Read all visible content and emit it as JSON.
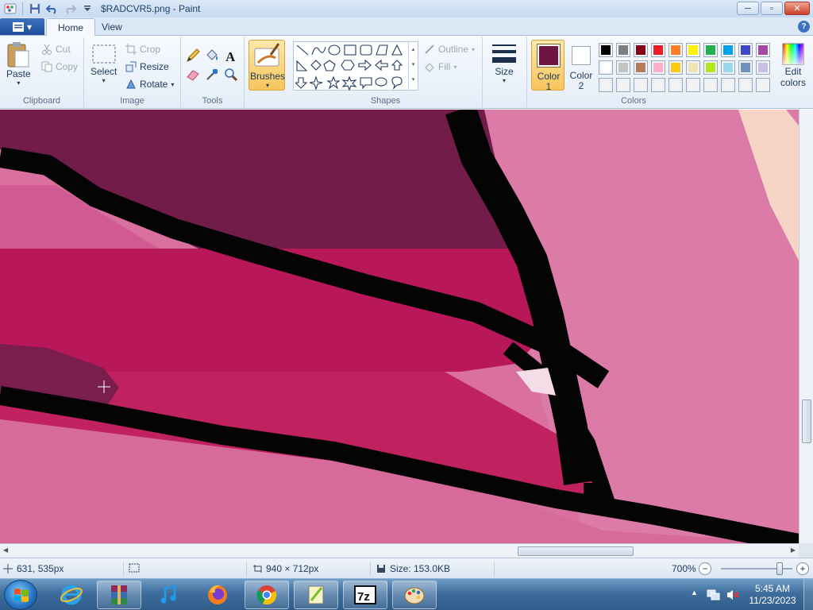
{
  "window": {
    "title": "$RADCVR5.png - Paint",
    "controls": {
      "minimize": "─",
      "maximize": "▫",
      "close": "✕"
    }
  },
  "tabs": {
    "app_menu": "▾",
    "home": "Home",
    "view": "View",
    "help": "?"
  },
  "ribbon": {
    "clipboard": {
      "label": "Clipboard",
      "paste": "Paste",
      "cut": "Cut",
      "copy": "Copy"
    },
    "image": {
      "label": "Image",
      "select": "Select",
      "crop": "Crop",
      "resize": "Resize",
      "rotate": "Rotate"
    },
    "tools": {
      "label": "Tools"
    },
    "brushes": {
      "label": "Brushes"
    },
    "shapes": {
      "label": "Shapes",
      "outline": "Outline",
      "fill": "Fill"
    },
    "size": {
      "label": "Size"
    },
    "color1": {
      "label": "Color",
      "number": "1",
      "value": "#6e1541"
    },
    "color2": {
      "label": "Color",
      "number": "2",
      "value": "#ffffff"
    },
    "colors": {
      "label": "Colors",
      "edit": "Edit",
      "edit2": "colors",
      "row1": [
        "#000000",
        "#7f7f7f",
        "#880015",
        "#ed1c24",
        "#ff7f27",
        "#fff200",
        "#22b14c",
        "#00a2e8",
        "#3f48cc",
        "#a349a4"
      ],
      "row2": [
        "#ffffff",
        "#c3c3c3",
        "#b97a57",
        "#ffaec9",
        "#ffc90e",
        "#efe4b0",
        "#b5e61d",
        "#99d9ea",
        "#7092be",
        "#c8bfe7"
      ],
      "row3": [
        "#f3f3f3",
        "#f3f3f3",
        "#f3f3f3",
        "#f3f3f3",
        "#f3f3f3",
        "#f3f3f3",
        "#f3f3f3",
        "#f3f3f3",
        "#f3f3f3",
        "#f3f3f3"
      ]
    }
  },
  "status": {
    "cursor_pos": "631, 535px",
    "image_dims": "940 × 712px",
    "file_size": "Size: 153.0KB",
    "zoom": "700%",
    "zoom_minus": "−",
    "zoom_plus": "+"
  },
  "taskbar": {
    "time": "5:45 AM",
    "date": "11/23/2023",
    "apps": [
      "WinRAR",
      "iTunes",
      "Firefox",
      "Chrome",
      "Notepad++",
      "7-Zip",
      "Paint"
    ]
  }
}
